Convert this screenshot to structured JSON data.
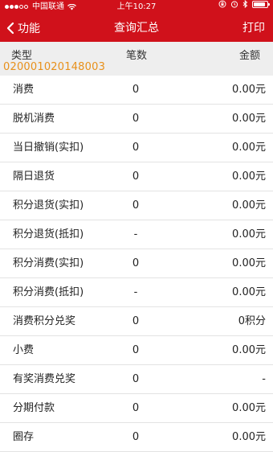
{
  "status_bar": {
    "carrier": "中国联通",
    "time": "上午10:27",
    "battery_level": 0.85
  },
  "nav": {
    "back_label": "功能",
    "title": "查询汇总",
    "print_label": "打印"
  },
  "table": {
    "headers": {
      "type": "类型",
      "count": "笔数",
      "amount": "金额"
    },
    "merchant_no": "020001020148003",
    "rows": [
      {
        "type": "消费",
        "count": "0",
        "amount": "0.00元"
      },
      {
        "type": "脱机消费",
        "count": "0",
        "amount": "0.00元"
      },
      {
        "type": "当日撤销(实扣)",
        "count": "0",
        "amount": "0.00元"
      },
      {
        "type": "隔日退货",
        "count": "0",
        "amount": "0.00元"
      },
      {
        "type": "积分退货(实扣)",
        "count": "0",
        "amount": "0.00元"
      },
      {
        "type": "积分退货(抵扣)",
        "count": "-",
        "amount": "0.00元"
      },
      {
        "type": "积分消费(实扣)",
        "count": "0",
        "amount": "0.00元"
      },
      {
        "type": "积分消费(抵扣)",
        "count": "-",
        "amount": "0.00元"
      },
      {
        "type": "消费积分兑奖",
        "count": "0",
        "amount": "0积分"
      },
      {
        "type": "小费",
        "count": "0",
        "amount": "0.00元"
      },
      {
        "type": "有奖消费兑奖",
        "count": "0",
        "amount": "-"
      },
      {
        "type": "分期付款",
        "count": "0",
        "amount": "0.00元"
      },
      {
        "type": "圈存",
        "count": "0",
        "amount": "0.00元"
      }
    ]
  },
  "colors": {
    "brand_red": "#d0111b",
    "merchant_orange": "#e8901a",
    "header_gray": "#eeeeee"
  }
}
